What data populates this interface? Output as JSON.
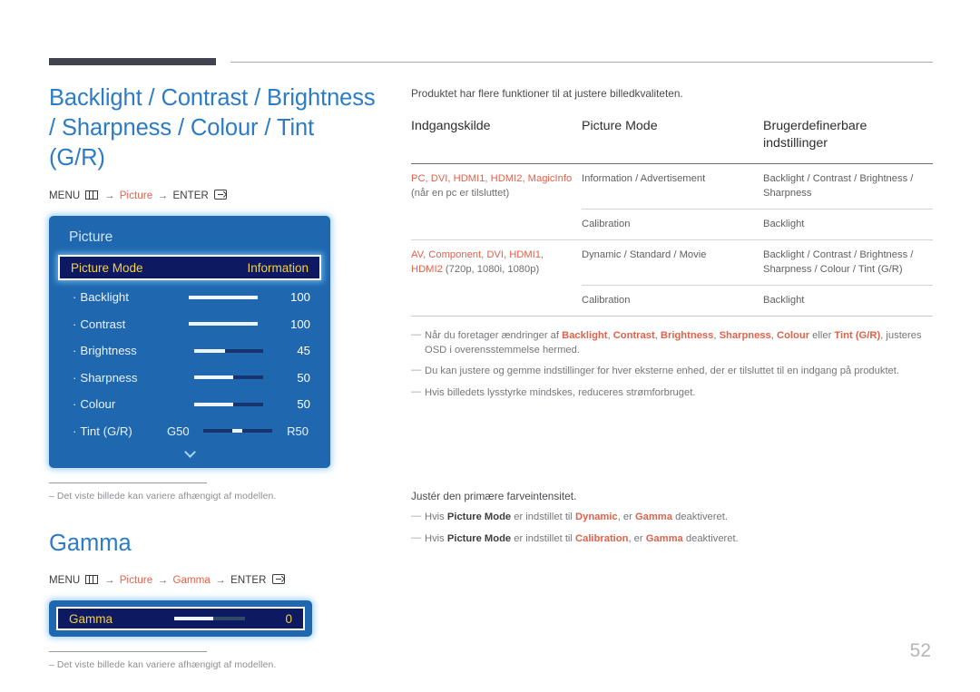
{
  "page": {
    "number": "52"
  },
  "left": {
    "section_title": "Backlight / Contrast / Brightness / Sharpness / Colour / Tint (G/R)",
    "breadcrumb": {
      "menu_label": "MENU",
      "menu_icon": "menu-grid-icon",
      "arrow": "→",
      "step1": "Picture",
      "enter_label": "ENTER",
      "enter_icon": "enter-return-icon"
    },
    "osd": {
      "title": "Picture",
      "selected_row": {
        "label": "Picture Mode",
        "value": "Information"
      },
      "rows": [
        {
          "label": "Backlight",
          "bullet": "·",
          "value": "100",
          "fill_pct": 100,
          "left_label": "",
          "right_label": ""
        },
        {
          "label": "Contrast",
          "bullet": "·",
          "value": "100",
          "fill_pct": 100,
          "left_label": "",
          "right_label": ""
        },
        {
          "label": "Brightness",
          "bullet": "·",
          "value": "45",
          "fill_pct": 45,
          "left_label": "",
          "right_label": ""
        },
        {
          "label": "Sharpness",
          "bullet": "·",
          "value": "50",
          "fill_pct": 50,
          "left_label": "",
          "right_label": ""
        },
        {
          "label": "Colour",
          "bullet": "·",
          "value": "50",
          "fill_pct": 50,
          "left_label": "",
          "right_label": ""
        },
        {
          "label": "Tint (G/R)",
          "bullet": "·",
          "value": "",
          "fill_pct": 0,
          "left_label": "G50",
          "right_label": "R50"
        }
      ],
      "scroll_hint_icon": "chevron-down-icon"
    },
    "caption1": "Det viste billede kan variere afhængigt af modellen.",
    "gamma": {
      "title": "Gamma",
      "breadcrumb": {
        "menu_label": "MENU",
        "arrow": "→",
        "step1": "Picture",
        "step2": "Gamma",
        "enter_label": "ENTER"
      },
      "osd": {
        "label": "Gamma",
        "value": "0",
        "fill_pct": 55
      },
      "caption": "Det viste billede kan variere afhængigt af modellen."
    }
  },
  "right": {
    "intro": "Produktet har flere funktioner til at justere billedkvaliteten.",
    "table": {
      "headers": [
        "Indgangskilde",
        "Picture Mode",
        "Brugerdefinerbare indstillinger"
      ],
      "rows": [
        {
          "source_accent": "PC, DVI, HDMI1, HDMI2, MagicInfo",
          "source_plain": "(når en pc er tilsluttet)",
          "mode": "Information / Advertisement",
          "settings": "Backlight / Contrast / Brightness / Sharpness"
        },
        {
          "source_accent": "",
          "source_plain": "",
          "mode": "Calibration",
          "settings": "Backlight"
        },
        {
          "source_accent": "AV, Component, DVI, HDMI1, HDMI2",
          "source_plain": "(720p, 1080i, 1080p)",
          "mode": "Dynamic / Standard / Movie",
          "settings": "Backlight / Contrast / Brightness / Sharpness / Colour / Tint (G/R)"
        },
        {
          "source_accent": "",
          "source_plain": "",
          "mode": "Calibration",
          "settings": "Backlight"
        }
      ]
    },
    "notes": [
      "Når du foretager ændringer af Backlight, Contrast, Brightness, Sharpness, Colour eller Tint (G/R), justeres OSD i overensstemmelse hermed.",
      "Du kan justere og gemme indstillinger for hver eksterne enhed, der er tilsluttet til en indgang på produktet.",
      "Hvis billedets lysstyrke mindskes, reduceres strømforbruget."
    ],
    "note1_parts": {
      "p1": "Når du foretager ændringer af ",
      "t1": "Backlight",
      "p2": ", ",
      "t2": "Contrast",
      "p3": ", ",
      "t3": "Brightness",
      "p4": ", ",
      "t4": "Sharpness",
      "p5": ", ",
      "t5": "Colour",
      "p6": " eller ",
      "t6": "Tint (G/R)",
      "p7": ", justeres OSD i overensstemmelse hermed."
    },
    "lower": {
      "intro": "Justér den primære farveintensitet.",
      "note1": {
        "p1": "Hvis ",
        "t1": "Picture Mode",
        "p2": " er indstillet til ",
        "t2": "Dynamic",
        "p3": ", er ",
        "t3": "Gamma",
        "p4": " deaktiveret."
      },
      "note2": {
        "p1": "Hvis ",
        "t1": "Picture Mode",
        "p2": " er indstillet til ",
        "t2": "Calibration",
        "p3": ", er ",
        "t3": "Gamma",
        "p4": " deaktiveret."
      }
    }
  },
  "colors": {
    "accent_orange": "#e2614a",
    "title_blue": "#2b7cc4",
    "osd_blue": "#1f68b0",
    "osd_selected": "#0d1a62",
    "osd_yellow": "#f4d03f"
  }
}
